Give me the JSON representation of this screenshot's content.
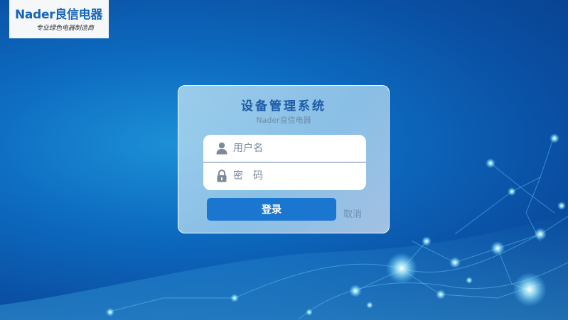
{
  "logo": {
    "brand": "Nader良信电器",
    "tagline": "专业绿色电器制造商"
  },
  "login": {
    "title": "设备管理系统",
    "subtitle": "Nader良信电器",
    "username_placeholder": "用户名",
    "password_placeholder": "密　码",
    "username_value": "",
    "password_value": "",
    "login_label": "登录",
    "cancel_label": "取消"
  },
  "colors": {
    "brand_blue": "#1565b8",
    "title_blue": "#1d5aa6",
    "button_blue": "#1b76cf",
    "cancel_text": "#6d8fb5"
  },
  "icons": {
    "username": "user-icon",
    "password": "lock-icon"
  }
}
